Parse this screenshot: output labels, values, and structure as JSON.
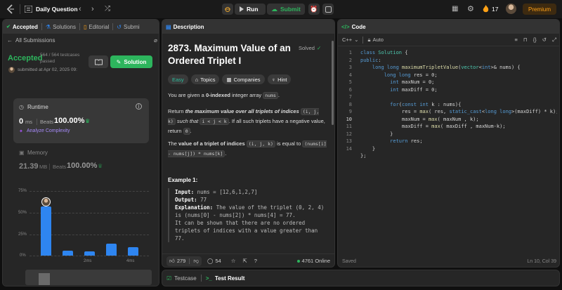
{
  "header": {
    "title": "Daily Question",
    "run_label": "Run",
    "submit_label": "Submit",
    "streak": "17",
    "premium_label": "Premium"
  },
  "left": {
    "tabs": [
      "Accepted",
      "Solutions",
      "Editorial",
      "Submi"
    ],
    "all_submissions": "All Submissions",
    "status": "Accepted",
    "testcases": "564 / 564 testcases passed",
    "submitted_at": "submitted at Apr 02, 2025 09:",
    "solution_label": "Solution",
    "runtime_label": "Runtime",
    "runtime_value": "0",
    "runtime_unit": "ms",
    "beats_label": "Beats",
    "runtime_beats": "100.00%",
    "analyze_label": "Analyze Complexity",
    "memory_label": "Memory",
    "memory_value": "21.39",
    "memory_unit": "MB",
    "memory_beats": "100.00%"
  },
  "chart_data": {
    "type": "bar",
    "y_ticks": [
      "75%",
      "50%",
      "25%",
      "0%"
    ],
    "ylim": [
      0,
      75
    ],
    "x_labels": [
      "2ms",
      "4ms"
    ],
    "values": [
      57,
      6,
      5,
      14,
      10
    ],
    "mini_labels": [
      "1ms",
      "2ms",
      "3ms",
      "4ms"
    ],
    "color": "#2e85f0"
  },
  "desc": {
    "tab": "Description",
    "title": "2873. Maximum Value of an Ordered Triplet I",
    "solved": "Solved",
    "tags": [
      "Easy",
      "Topics",
      "Companies",
      "Hint"
    ],
    "p1a": "You are given a",
    "p1b": "0-indexed",
    "p1c": "integer array",
    "p1code": "nums",
    "p2a": "Return",
    "p2b": "the maximum value over all triplets of indices",
    "p2code1": "(i, j, k)",
    "p2c": "such that",
    "p2code2": "i < j < k",
    "p2d": ". If all such triplets have a negative value, return",
    "p2code3": "0",
    "p3a": "The",
    "p3b": "value of a triplet of indices",
    "p3code1": "(i, j, k)",
    "p3c": "is equal to",
    "p3code2": "(nums[i] - nums[j]) * nums[k]",
    "example_title": "Example 1:",
    "input_label": "Input:",
    "input_value": "nums = [12,6,1,2,7]",
    "output_label": "Output:",
    "output_value": "77",
    "explanation_label": "Explanation:",
    "explanation_text": "The value of the triplet (0, 2, 4) is (nums[0] - nums[2]) * nums[4] = 77.",
    "explanation_more": "It can be shown that there are no ordered triplets of indices with a value greater than 77.",
    "likes": "279",
    "comments": "54",
    "online": "4761 Online"
  },
  "code": {
    "tab": "Code",
    "lang": "C++",
    "auto": "Auto",
    "saved": "Saved",
    "cursor": "Ln 10, Col 39",
    "lines": [
      "1",
      "2",
      "3",
      "4",
      "5",
      "6",
      "7",
      "8",
      "9",
      "10",
      "11",
      "12",
      "13",
      "14"
    ]
  },
  "bottom": {
    "testcase": "Testcase",
    "test_result": "Test Result"
  }
}
